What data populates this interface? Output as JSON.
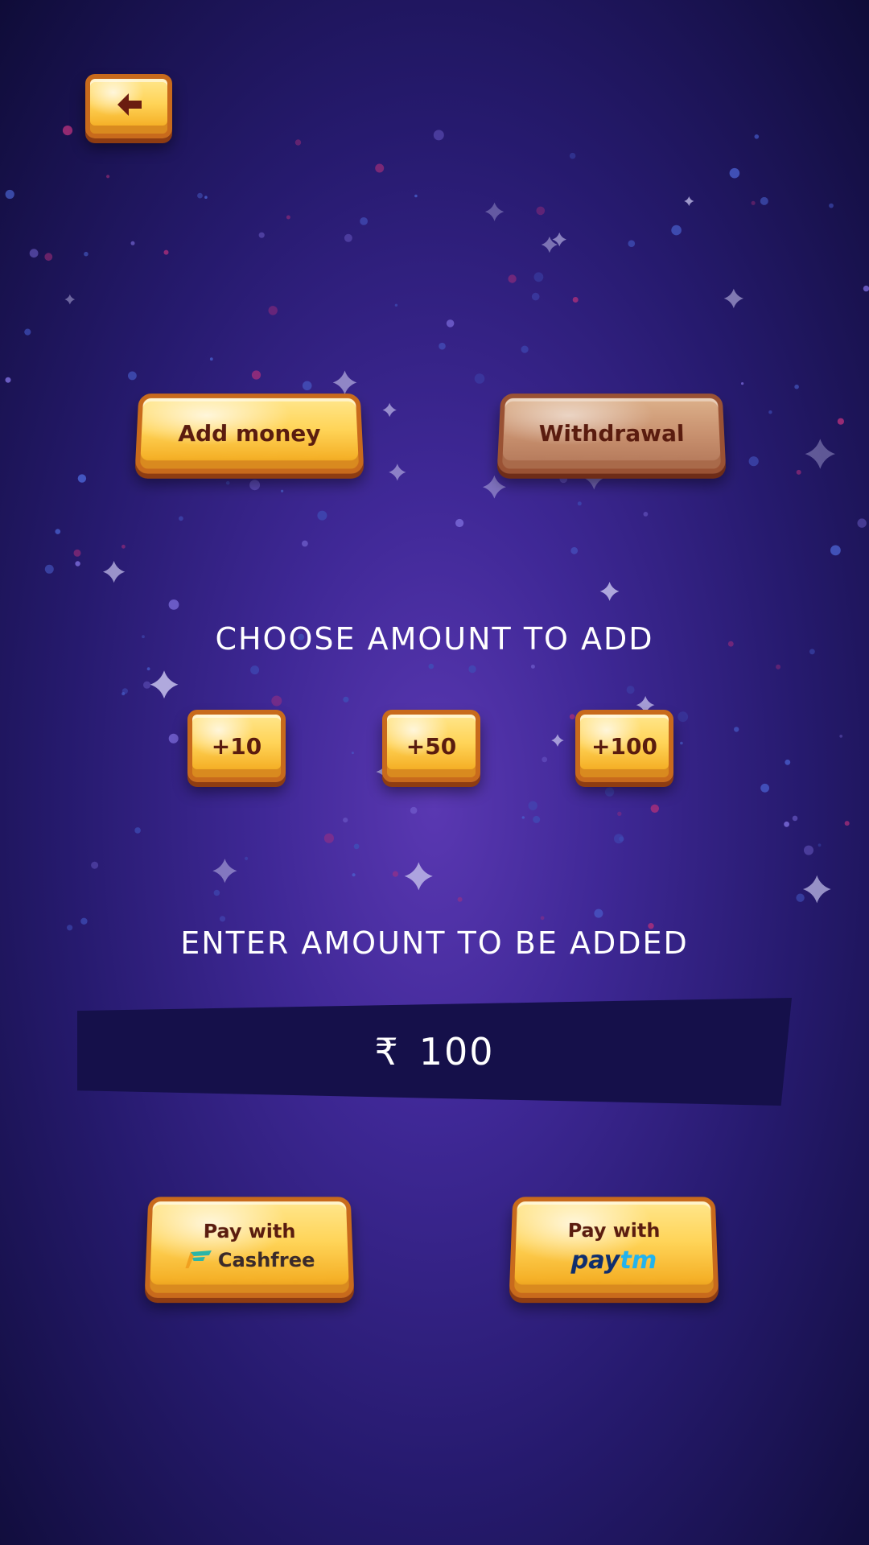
{
  "colors": {
    "background_center": "#5a38b2",
    "background_edge": "#0f0c38",
    "button_gold": "#ffd458",
    "button_text": "#5a1c0f",
    "input_bg": "#15104a",
    "paytm_dark": "#0e2e6e",
    "paytm_light": "#22b3ee"
  },
  "header": {
    "back_icon": "back-arrow-icon"
  },
  "tabs": {
    "add_money": "Add money",
    "withdrawal": "Withdrawal"
  },
  "choose": {
    "title": "CHOOSE AMOUNT TO ADD",
    "chips": [
      "+10",
      "+50",
      "+100"
    ]
  },
  "enter": {
    "title": "ENTER AMOUNT TO BE ADDED",
    "currency_symbol": "₹",
    "value": "100"
  },
  "payment": {
    "cashfree": {
      "label": "Pay with",
      "brand": "Cashfree",
      "icon": "cashfree-logo-icon"
    },
    "paytm": {
      "label": "Pay with",
      "brand_part1": "pay",
      "brand_part2": "tm"
    }
  }
}
